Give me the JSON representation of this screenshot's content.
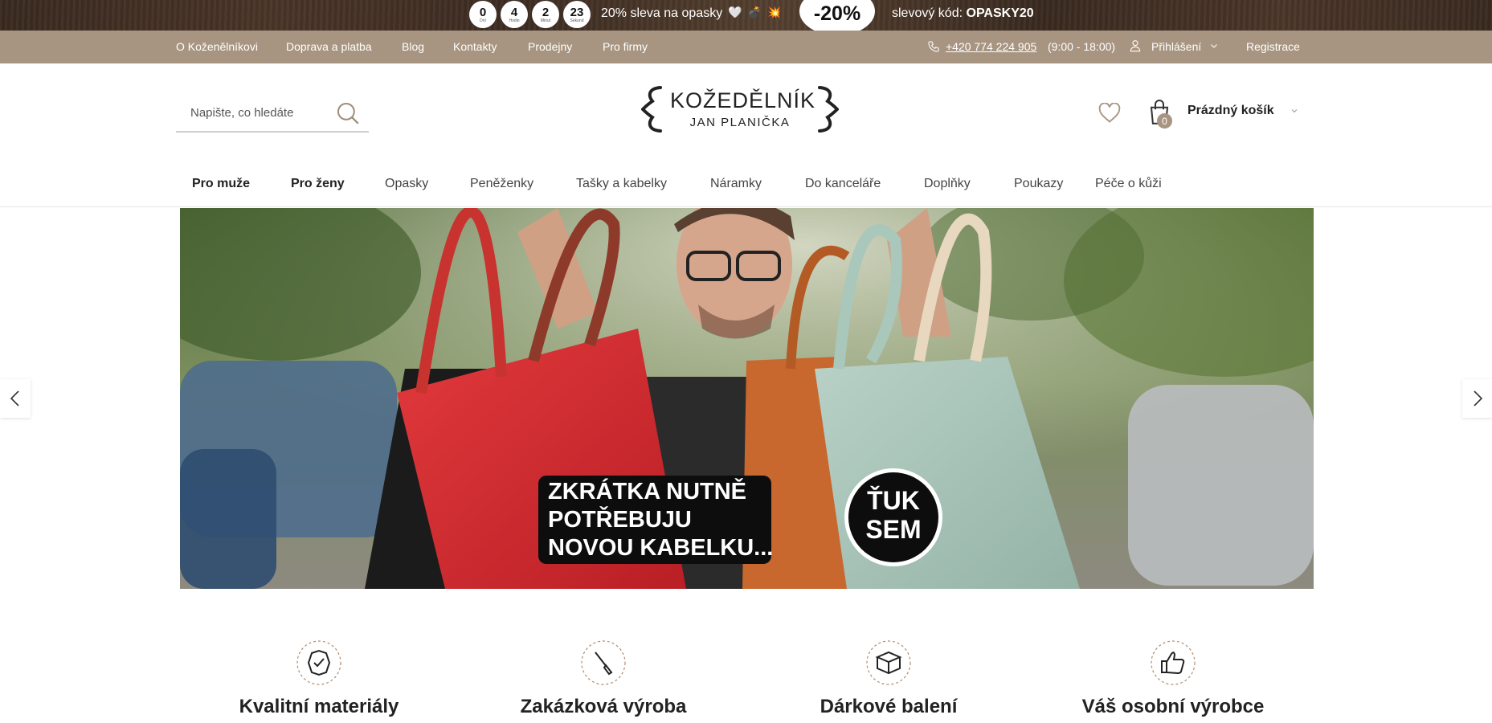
{
  "promo": {
    "countdown": [
      {
        "value": "0",
        "unit": "Dní"
      },
      {
        "value": "4",
        "unit": "Hodin"
      },
      {
        "value": "2",
        "unit": "Minut"
      },
      {
        "value": "23",
        "unit": "Sekund"
      }
    ],
    "text": "20% sleva na opasky",
    "emoji": [
      "🤍",
      "💣",
      "💥"
    ],
    "discount": "-20%",
    "code_label": "slevový kód:",
    "code": "OPASKY20"
  },
  "topnav": {
    "links": [
      "O Koženělníkovi",
      "Doprava a platba",
      "Blog",
      "Kontakty",
      "Prodejny",
      "Pro firmy"
    ],
    "phone": "+420 774 224 905",
    "hours": "(9:00 - 18:00)",
    "login": "Přihlášení",
    "register": "Registrace"
  },
  "search": {
    "placeholder": "Napište, co hledáte"
  },
  "logo": {
    "main": "KOŽEDĚLNÍK",
    "sub": "JAN PLANIČKA"
  },
  "cart": {
    "count": "0",
    "label": "Prázdný košík"
  },
  "menu": [
    {
      "label": "Pro muže",
      "bold": true
    },
    {
      "label": "Pro ženy",
      "bold": true
    },
    {
      "label": "Opasky",
      "bold": false
    },
    {
      "label": "Peněženky",
      "bold": false
    },
    {
      "label": "Tašky a kabelky",
      "bold": false
    },
    {
      "label": "Náramky",
      "bold": false
    },
    {
      "label": "Do kanceláře",
      "bold": false
    },
    {
      "label": "Doplňky",
      "bold": false
    },
    {
      "label": "Poukazy",
      "bold": false
    },
    {
      "label": "Péče o kůži",
      "bold": false
    }
  ],
  "hero": {
    "caption_lines": [
      "ZKRÁTKA NUTNĚ",
      "POTŘEBUJU",
      "NOVOU KABELKU..."
    ],
    "button_lines": [
      "ŤUK",
      "SEM"
    ]
  },
  "features": [
    {
      "title": "Kvalitní materiály",
      "icon": "leather-badge-icon"
    },
    {
      "title": "Zakázková výroba",
      "icon": "awl-tool-icon"
    },
    {
      "title": "Dárkové balení",
      "icon": "gift-box-icon"
    },
    {
      "title": "Váš osobní výrobce",
      "icon": "thumbs-up-icon"
    }
  ],
  "colors": {
    "topnav_bg": "#a89581",
    "accent": "#a89581",
    "text": "#222222"
  }
}
